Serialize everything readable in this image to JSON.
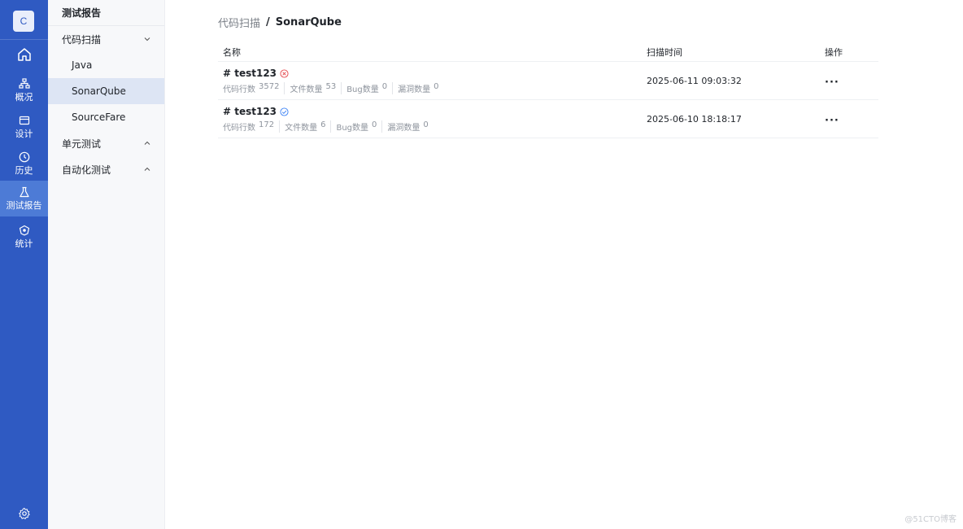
{
  "rail": {
    "logo": "C",
    "items": [
      {
        "label": "概况",
        "icon": "hierarchy-icon"
      },
      {
        "label": "设计",
        "icon": "card-icon"
      },
      {
        "label": "历史",
        "icon": "clock-icon"
      },
      {
        "label": "测试报告",
        "icon": "flask-icon",
        "active": true
      },
      {
        "label": "统计",
        "icon": "shield-icon"
      }
    ]
  },
  "subnav": {
    "title": "测试报告",
    "groups": [
      {
        "label": "代码扫描",
        "expanded": true,
        "children": [
          "Java",
          "SonarQube",
          "SourceFare"
        ],
        "active_child": "SonarQube"
      },
      {
        "label": "单元测试",
        "expanded": false
      },
      {
        "label": "自动化测试",
        "expanded": false
      }
    ]
  },
  "breadcrumb": {
    "parent": "代码扫描",
    "separator": "/",
    "current": "SonarQube"
  },
  "table": {
    "headers": {
      "name": "名称",
      "time": "扫描时间",
      "op": "操作"
    },
    "rows": [
      {
        "title": "# test123",
        "status": "failed",
        "metrics": [
          {
            "label": "代码行数",
            "value": "3572"
          },
          {
            "label": "文件数量",
            "value": "53"
          },
          {
            "label": "Bug数量",
            "value": "0"
          },
          {
            "label": "漏洞数量",
            "value": "0"
          }
        ],
        "time": "2025-06-11 09:03:32",
        "more": "···"
      },
      {
        "title": "# test123",
        "status": "passed",
        "metrics": [
          {
            "label": "代码行数",
            "value": "172"
          },
          {
            "label": "文件数量",
            "value": "6"
          },
          {
            "label": "Bug数量",
            "value": "0"
          },
          {
            "label": "漏洞数量",
            "value": "0"
          }
        ],
        "time": "2025-06-10 18:18:17",
        "more": "···"
      }
    ]
  },
  "colors": {
    "rail": "#2f5ac2",
    "rail_active": "#4d7bd6",
    "failed": "#e5484d",
    "passed": "#3b82f6"
  },
  "watermark": "@51CTO博客"
}
